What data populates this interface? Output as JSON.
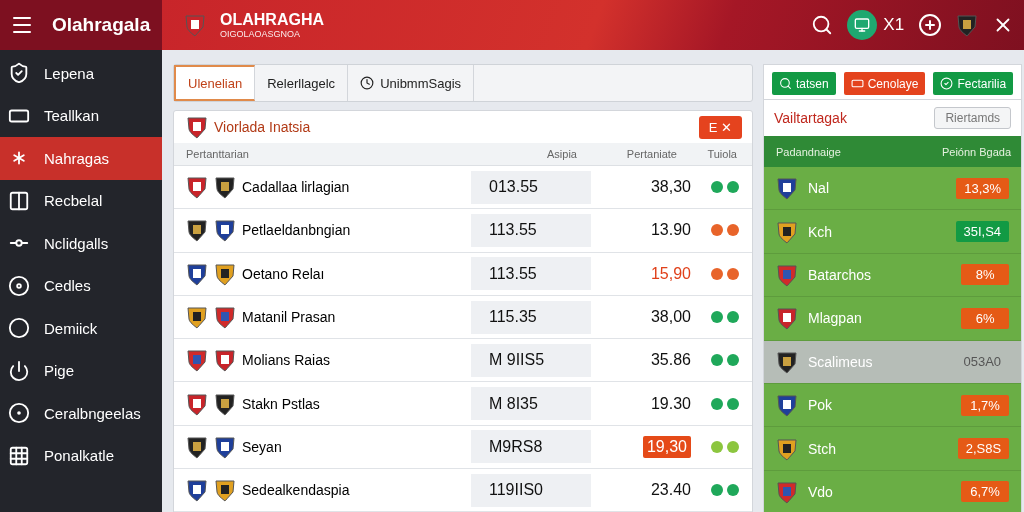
{
  "app": {
    "title": "Olahragala",
    "brand": "OLAHRAGHA",
    "brand_sub": "OIGOLAOASGNOA",
    "counter": "X1"
  },
  "sidebar": {
    "items": [
      {
        "label": "Lepena",
        "selected": false
      },
      {
        "label": "Teallkan",
        "selected": false
      },
      {
        "label": "Nahragas",
        "selected": true
      },
      {
        "label": "Recbelal",
        "selected": false
      },
      {
        "label": "Nclidgalls",
        "selected": false
      },
      {
        "label": "Cedles",
        "selected": false
      },
      {
        "label": "Demiick",
        "selected": false
      },
      {
        "label": "Pige",
        "selected": false
      },
      {
        "label": "Ceralbngeelas",
        "selected": false
      },
      {
        "label": "Ponalkatle",
        "selected": false
      }
    ]
  },
  "tabs": [
    {
      "label": "Ulenelian",
      "selected": true
    },
    {
      "label": "Relerllagelc",
      "selected": false
    },
    {
      "label": "UnibmmSagis",
      "selected": false
    }
  ],
  "panel": {
    "title": "Viorlada Inatsia",
    "action": "E ✕",
    "columns": [
      "Pertanttarian",
      "Asipia",
      "Pertaniate",
      "Tuiola"
    ],
    "rows": [
      {
        "name": "Cadallaa lirlagian",
        "value": "013.55",
        "odds": "38,30",
        "kind": "plain",
        "color": "#1fa85a"
      },
      {
        "name": "Petlaeldanbngian",
        "value": "113.55",
        "odds": "13.90",
        "kind": "plain",
        "color": "#e8642a"
      },
      {
        "name": "Oetano Relaı",
        "value": "113.55",
        "odds": "15,90",
        "kind": "alert",
        "color": "#e8642a"
      },
      {
        "name": "Matanil Prasan",
        "value": "115.35",
        "odds": "38,00",
        "kind": "plain",
        "color": "#1fa85a"
      },
      {
        "name": "Molians Raias",
        "value": "M 9IIS5",
        "odds": "35.86",
        "kind": "plain",
        "color": "#1fa85a"
      },
      {
        "name": "Stakn Pstlas",
        "value": "M 8I35",
        "odds": "19.30",
        "kind": "plain",
        "color": "#1fa85a"
      },
      {
        "name": "Seyan",
        "value": "M9RS8",
        "odds": "19,30",
        "kind": "badge",
        "color": "#8cc63f"
      },
      {
        "name": "Sedealkendaspia",
        "value": "119IIS0",
        "odds": "23.40",
        "kind": "plain",
        "color": "#1fa85a"
      }
    ]
  },
  "side_panel": {
    "buttons": [
      {
        "label": "tatsen",
        "kind": "green"
      },
      {
        "label": "Cenolaye",
        "kind": "red"
      },
      {
        "label": "Fectarilia",
        "kind": "green"
      }
    ],
    "title": "Vailtartagak",
    "action": "Riertamds",
    "columns": [
      "Padandnaige",
      "Peiónn Bgada"
    ],
    "rows": [
      {
        "name": "Nal",
        "value": "13,3%",
        "kind": "red",
        "selected": false
      },
      {
        "name": "Kch",
        "value": "35Ӏ,S4",
        "kind": "green",
        "selected": false
      },
      {
        "name": "Batarchos",
        "value": "8%",
        "kind": "red",
        "selected": false
      },
      {
        "name": "Mlagpan",
        "value": "6%",
        "kind": "red",
        "selected": false
      },
      {
        "name": "Scalimeus",
        "value": "053A0",
        "kind": "plain",
        "selected": true
      },
      {
        "name": "Pok",
        "value": "1,7%",
        "kind": "red",
        "selected": false
      },
      {
        "name": "Stch",
        "value": "2,S8S",
        "kind": "red",
        "selected": false
      },
      {
        "name": "Vdo",
        "value": "6,7%",
        "kind": "red",
        "selected": false
      }
    ]
  }
}
